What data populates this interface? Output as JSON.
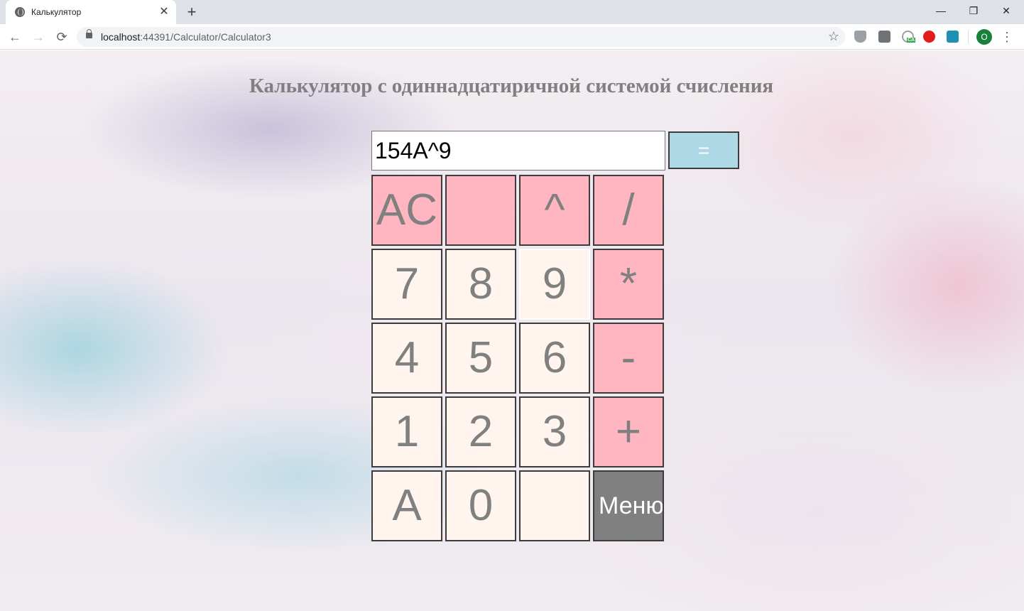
{
  "browser": {
    "tab_title": "Калькулятор",
    "tab_close": "✕",
    "new_tab": "+",
    "url_host": "localhost",
    "url_rest": ":44391/Calculator/Calculator3",
    "avatar_letter": "O",
    "window_controls": {
      "minimize": "—",
      "restore": "❐",
      "close": "✕"
    },
    "nav": {
      "back": "←",
      "forward": "→",
      "reload": "⟳"
    },
    "bookmark_star": "☆",
    "menu": "⋮",
    "extension_badge": "CA"
  },
  "page": {
    "title": "Калькулятор с одиннадцатиричной системой счисления",
    "display_value": "154A^9",
    "equals_label": "=",
    "keys": [
      [
        "AC",
        "",
        "^",
        "/"
      ],
      [
        "7",
        "8",
        "9",
        "*"
      ],
      [
        "4",
        "5",
        "6",
        "-"
      ],
      [
        "1",
        "2",
        "3",
        "+"
      ],
      [
        "A",
        "0",
        "",
        "Меню"
      ]
    ]
  }
}
